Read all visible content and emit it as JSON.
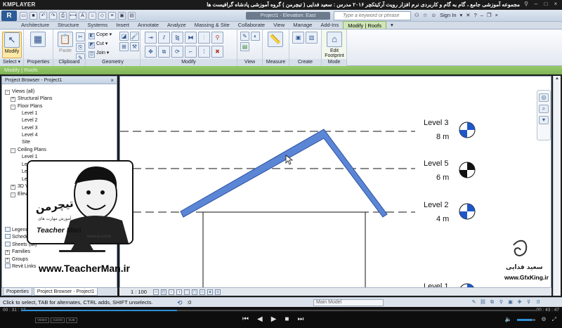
{
  "player": {
    "logo": "KMPLAYER",
    "caption": "مجموعه آموزشی جامع ، گام به گام و کاربردی نرم افزار رویت آرکیتکچر ۲۰۱۶ مدرس : سعید فدایی ( تیچرمن ) گروه آموزشی پادشاه گرافیست ها",
    "time_elapsed": "00 : 31 : 12",
    "time_total": "00 : 43 : 47",
    "progress": 0.3,
    "volume": 0.8,
    "badges": [
      "VIDEO",
      "AUDIO",
      "SUB"
    ]
  },
  "app": {
    "logo": "R",
    "doc_title": "Project1 - Elevation: East",
    "search_placeholder": "Type a keyword or phrase",
    "signin": "Sign In"
  },
  "ribbon": {
    "tabs": [
      {
        "label": "Architecture",
        "active": false
      },
      {
        "label": "Structure",
        "active": false
      },
      {
        "label": "Systems",
        "active": false
      },
      {
        "label": "Insert",
        "active": false
      },
      {
        "label": "Annotate",
        "active": false
      },
      {
        "label": "Analyze",
        "active": false
      },
      {
        "label": "Massing & Site",
        "active": false
      },
      {
        "label": "Collaborate",
        "active": false
      },
      {
        "label": "View",
        "active": false
      },
      {
        "label": "Manage",
        "active": false
      },
      {
        "label": "Add-Ins",
        "active": false
      },
      {
        "label": "Modify | Roofs",
        "active": true
      }
    ],
    "panels": {
      "select": "Select",
      "properties": "Properties",
      "clipboard": "Clipboard",
      "geometry": "Geometry",
      "modify": "Modify",
      "view": "View",
      "measure": "Measure",
      "create": "Create",
      "mode": "Mode"
    },
    "buttons": {
      "modify": "Modify",
      "paste": "Paste",
      "cope": "Cope",
      "cut": "Cut",
      "join": "Join",
      "edit_footprint": "Edit Footprint"
    }
  },
  "context_label": "Modify | Roofs",
  "project_browser": {
    "title": "Project Browser - Project1",
    "tree": [
      {
        "label": "Views (all)",
        "toggle": "-"
      },
      {
        "label": "Structural Plans",
        "toggle": "+"
      },
      {
        "label": "Floor Plans",
        "toggle": "-"
      },
      {
        "label": "Level 1",
        "toggle": ""
      },
      {
        "label": "Level 2",
        "toggle": ""
      },
      {
        "label": "Level 3",
        "toggle": ""
      },
      {
        "label": "Level 4",
        "toggle": ""
      },
      {
        "label": "Site",
        "toggle": ""
      },
      {
        "label": "Ceiling Plans",
        "toggle": "-"
      },
      {
        "label": "Level 1",
        "toggle": ""
      },
      {
        "label": "Level 2",
        "toggle": ""
      },
      {
        "label": "Level 3",
        "toggle": ""
      },
      {
        "label": "Level 4",
        "toggle": ""
      },
      {
        "label": "3D Views",
        "toggle": "+"
      },
      {
        "label": "Elevations (Building Elevation)",
        "toggle": "-"
      },
      {
        "label": "Legends",
        "toggle": ""
      },
      {
        "label": "Schedules/Quantities",
        "toggle": ""
      },
      {
        "label": "Sheets (all)",
        "toggle": ""
      },
      {
        "label": "Families",
        "toggle": "+"
      },
      {
        "label": "Groups",
        "toggle": "+"
      },
      {
        "label": "Revit Links",
        "toggle": ""
      }
    ],
    "tabs": [
      "Properties",
      "Project Browser - Project1"
    ]
  },
  "logo_overlay": {
    "brand_fa": "تیچرمن",
    "tagline_fa": "آموزش مهارت های",
    "name": "Teacher Man",
    "sub": "learning activity",
    "website": "www.TeacherMan.ir"
  },
  "levels": [
    {
      "name": "Level 3",
      "elevation": "8 m",
      "head": "blue"
    },
    {
      "name": "Level 5",
      "elevation": "6 m",
      "head": "black"
    },
    {
      "name": "Level 2",
      "elevation": "4 m",
      "head": "blue"
    },
    {
      "name": "Level 1",
      "elevation": "",
      "head": "blue"
    }
  ],
  "watermark": {
    "name_fa": "سعید فدایی",
    "url": "www.GfxKing.ir"
  },
  "view_bar": {
    "scale": "1 : 100"
  },
  "status": {
    "text": "Click to select, TAB for alternates, CTRL adds, SHIFT unselects.",
    "workset_value": ":0",
    "model": "Main Model"
  },
  "colors": {
    "roof_fill": "#5b86d6",
    "roof_stroke": "#2a4fa0",
    "context_green": "#8cc063",
    "level_head_blue": "#1f57c7"
  }
}
